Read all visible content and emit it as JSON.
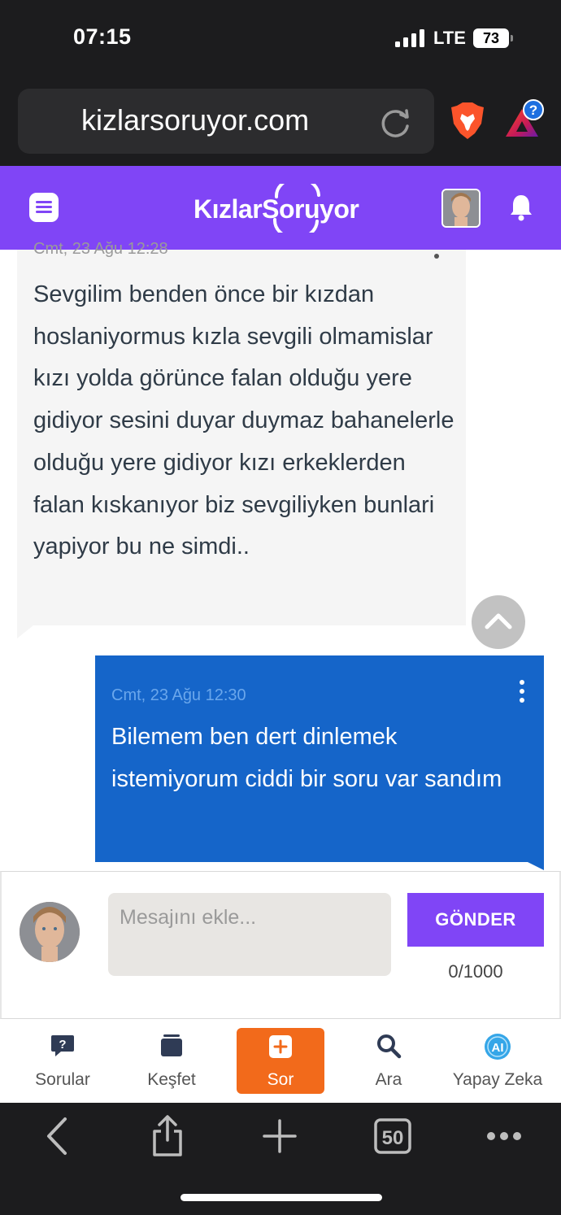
{
  "status_bar": {
    "time": "07:15",
    "network": "LTE",
    "battery": "73"
  },
  "browser": {
    "url": "kizlarsoruyor.com",
    "icons": [
      "reload-icon",
      "brave-lion-icon",
      "brave-rewards-icon"
    ],
    "rewards_badge": "?",
    "toolbar_icons": [
      "back-icon",
      "share-icon",
      "new-tab-icon",
      "tabs-icon",
      "more-icon"
    ],
    "tab_count": "50"
  },
  "site_header": {
    "logo_text": "KızlarSoruyor",
    "icons": [
      "menu-icon",
      "user-avatar",
      "bell-icon"
    ]
  },
  "messages": [
    {
      "time": "Cmt, 23 Ağu 12:28",
      "text": "Sevgilim benden önce bir kızdan hoslaniyormus kızla sevgili olmamislar kızı yolda görünce falan olduğu yere gidiyor sesini duyar duymaz bahanelerle olduğu yere gidiyor kızı erkeklerden falan kıskanıyor biz sevgiliyken bunlari yapiyor bu ne simdi..",
      "side": "left"
    },
    {
      "time": "Cmt, 23 Ağu 12:30",
      "text": "Bilemem ben dert dinlemek istemiyorum ciddi bir soru var sandım",
      "side": "right"
    }
  ],
  "composer": {
    "placeholder": "Mesajını ekle...",
    "value": "",
    "send_label": "GÖNDER",
    "counter": "0/1000"
  },
  "site_nav": {
    "items": [
      {
        "label": "Sorular",
        "icon": "question-bubble-icon"
      },
      {
        "label": "Keşfet",
        "icon": "stack-icon"
      },
      {
        "label": "Sor",
        "icon": "plus-icon"
      },
      {
        "label": "Ara",
        "icon": "search-icon"
      },
      {
        "label": "Yapay Zeka",
        "icon": "ai-icon"
      }
    ],
    "ai_badge": "AI"
  },
  "colors": {
    "brand_purple": "#8045f6",
    "own_message_blue": "#1565c9",
    "ask_orange": "#f26a1b",
    "browser_chrome": "#1c1c1e"
  }
}
